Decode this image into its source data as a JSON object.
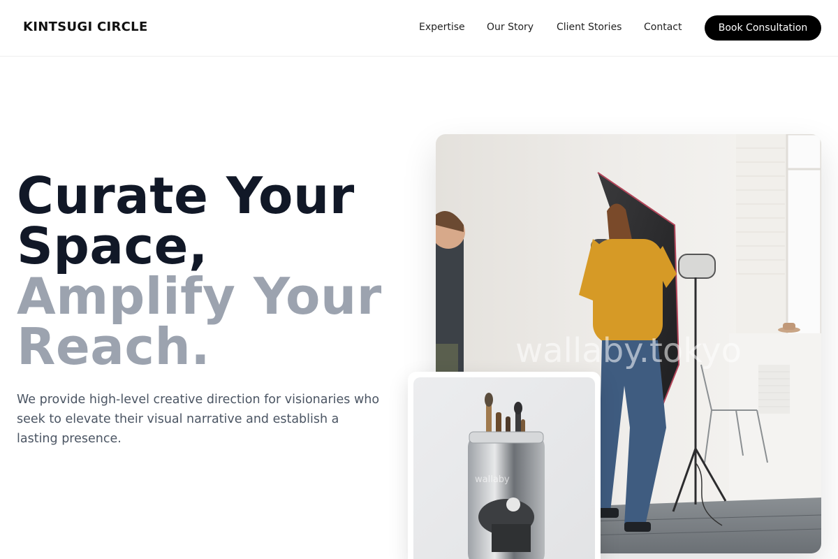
{
  "header": {
    "logo": "KINTSUGI CIRCLE",
    "nav": [
      "Expertise",
      "Our Story",
      "Client Stories",
      "Contact"
    ],
    "cta_label": "Book Consultation"
  },
  "hero": {
    "title_dark": [
      "Curate Your",
      "Space,"
    ],
    "title_muted": [
      "Amplify Your",
      "Reach."
    ],
    "description": "We provide high-level creative direction for visionaries who seek to elevate their visual narrative and establish a lasting presence."
  },
  "images": {
    "main_watermark": "wallaby.tokyo",
    "small_watermark": "wallaby"
  },
  "colors": {
    "title_dark": "#111827",
    "title_muted": "#9ca3af",
    "body_text": "#4b5563",
    "cta_bg": "#000000"
  }
}
